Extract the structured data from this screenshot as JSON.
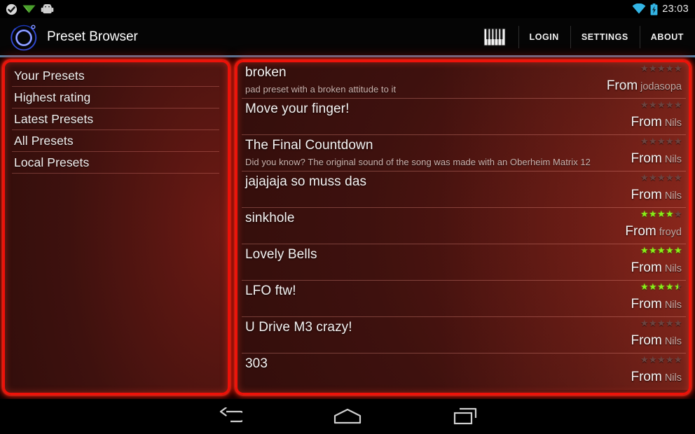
{
  "status_bar": {
    "icons": [
      "check-circle-icon",
      "green-triangle-icon",
      "android-head-icon"
    ],
    "wifi_icon": "wifi-icon",
    "battery_icon": "battery-charging-icon",
    "time": "23:03",
    "accent": "#33b5e5"
  },
  "action_bar": {
    "logo_icon": "knob-logo-icon",
    "title": "Preset Browser",
    "piano_icon": "piano-keyboard-icon",
    "actions": [
      {
        "label": "LOGIN",
        "name": "login"
      },
      {
        "label": "SETTINGS",
        "name": "settings"
      },
      {
        "label": "ABOUT",
        "name": "about"
      }
    ],
    "divider_color": "#5d9bc4"
  },
  "sidebar": {
    "items": [
      {
        "label": "Your Presets"
      },
      {
        "label": "Highest rating"
      },
      {
        "label": "Latest Presets"
      },
      {
        "label": "All Presets"
      },
      {
        "label": "Local Presets"
      }
    ]
  },
  "preset_list": {
    "from_label": "From",
    "items": [
      {
        "title": "broken",
        "subtitle": "pad preset with a broken attitude to it",
        "rating": 0,
        "author": "jodasopa"
      },
      {
        "title": "Move your finger!",
        "subtitle": "",
        "rating": 0,
        "author": "Nils"
      },
      {
        "title": "The Final Countdown",
        "subtitle": "Did you know? The original sound of the song was made with an Oberheim Matrix 12",
        "rating": 0,
        "author": "Nils"
      },
      {
        "title": "jajajaja so muss das",
        "subtitle": "",
        "rating": 0,
        "author": "Nils"
      },
      {
        "title": "sinkhole",
        "subtitle": "",
        "rating": 4,
        "author": "froyd"
      },
      {
        "title": "Lovely Bells",
        "subtitle": "",
        "rating": 5,
        "author": "Nils"
      },
      {
        "title": "LFO ftw!",
        "subtitle": "",
        "rating": 4.5,
        "author": "Nils"
      },
      {
        "title": "U Drive M3 crazy!",
        "subtitle": "",
        "rating": 0,
        "author": "Nils"
      },
      {
        "title": "303",
        "subtitle": "",
        "rating": 0,
        "author": "Nils"
      }
    ],
    "star_max": 5,
    "star_filled_color": "#8aee17",
    "star_empty_color": "#6b4440"
  },
  "nav_bar": {
    "buttons": [
      {
        "name": "back",
        "icon": "back-arrow-icon"
      },
      {
        "name": "home",
        "icon": "home-icon"
      },
      {
        "name": "recents",
        "icon": "recents-icon"
      }
    ]
  },
  "theme": {
    "panel_border": "#ef1109",
    "panel_glow": "#ff2a18",
    "panel_bg_dark": "#2c0c0a",
    "panel_bg_light": "#6d1a14",
    "text_primary": "#f6f3f2",
    "text_secondary": "#c4a8a3"
  }
}
